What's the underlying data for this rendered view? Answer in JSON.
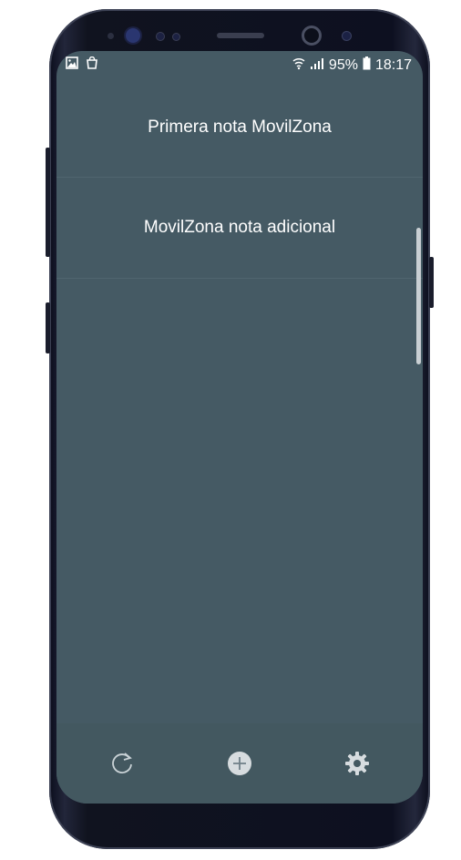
{
  "statusbar": {
    "left_icons": [
      "image-icon",
      "shopping-bag-icon"
    ],
    "battery_percent": "95%",
    "time": "18:17"
  },
  "notes": [
    {
      "title": "Primera nota MovilZona"
    },
    {
      "title": "MovilZona nota adicional"
    }
  ],
  "bottom_bar": {
    "buttons": [
      "refresh-icon",
      "add-icon",
      "settings-icon"
    ]
  },
  "colors": {
    "screen_background": "#455a64",
    "bottom_bar": "#435860",
    "text": "#ffffff"
  }
}
